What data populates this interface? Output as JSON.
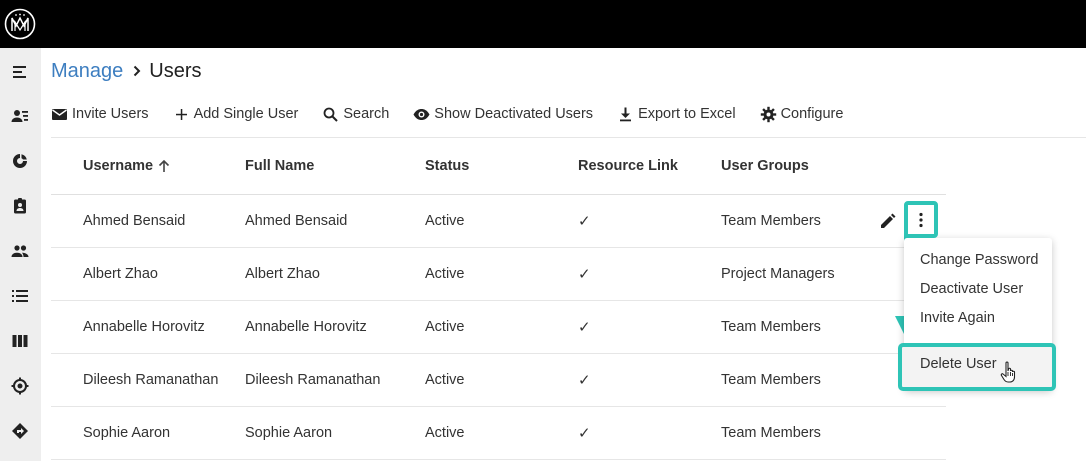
{
  "brand": {
    "logo_icon": "mm-monogram-logo"
  },
  "sidebar": {
    "items": [
      {
        "icon": "menu-lines-icon"
      },
      {
        "icon": "person-list-icon"
      },
      {
        "icon": "refresh-donut-icon"
      },
      {
        "icon": "assignment-ind-icon"
      },
      {
        "icon": "people-icon"
      },
      {
        "icon": "bulleted-list-icon"
      },
      {
        "icon": "columns-icon"
      },
      {
        "icon": "target-icon"
      },
      {
        "icon": "directions-icon"
      }
    ]
  },
  "breadcrumb": {
    "parent": "Manage",
    "current": "Users"
  },
  "toolbar": {
    "invite_users": "Invite Users",
    "add_single_user": "Add Single User",
    "search": "Search",
    "show_deactivated": "Show Deactivated Users",
    "export_excel": "Export to Excel",
    "configure": "Configure"
  },
  "table": {
    "headers": {
      "username": "Username",
      "full_name": "Full Name",
      "status": "Status",
      "resource_link": "Resource Link",
      "user_groups": "User Groups"
    },
    "rows": [
      {
        "username": "Ahmed Bensaid",
        "full_name": "Ahmed Bensaid",
        "status": "Active",
        "resource_link": "✓",
        "user_groups": "Team Members"
      },
      {
        "username": "Albert Zhao",
        "full_name": "Albert Zhao",
        "status": "Active",
        "resource_link": "✓",
        "user_groups": "Project Managers"
      },
      {
        "username": "Annabelle Horovitz",
        "full_name": "Annabelle Horovitz",
        "status": "Active",
        "resource_link": "✓",
        "user_groups": "Team Members"
      },
      {
        "username": "Dileesh Ramanathan",
        "full_name": "Dileesh Ramanathan",
        "status": "Active",
        "resource_link": "✓",
        "user_groups": "Team Members"
      },
      {
        "username": "Sophie Aaron",
        "full_name": "Sophie Aaron",
        "status": "Active",
        "resource_link": "✓",
        "user_groups": "Team Members"
      }
    ]
  },
  "context_menu": {
    "change_password": "Change Password",
    "deactivate_user": "Deactivate User",
    "invite_again": "Invite Again",
    "delete_user": "Delete User"
  },
  "colors": {
    "accent_highlight": "#2ec4b6",
    "link_blue": "#3d7ec0",
    "topbar": "#000000",
    "sidebar": "#eeeeee"
  }
}
